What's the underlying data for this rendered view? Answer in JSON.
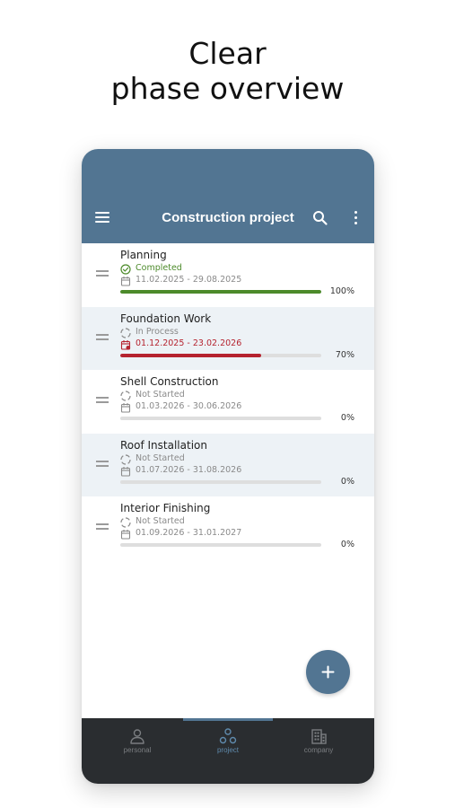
{
  "headline": {
    "line1": "Clear",
    "line2": "phase overview"
  },
  "appbar": {
    "title": "Construction project"
  },
  "phases": [
    {
      "name": "Planning",
      "status": "Completed",
      "status_type": "completed",
      "dates": "11.02.2025 - 29.08.2025",
      "date_overdue": false,
      "progress": 100,
      "progress_label": "100%"
    },
    {
      "name": "Foundation Work",
      "status": "In Process",
      "status_type": "in-process",
      "dates": "01.12.2025 - 23.02.2026",
      "date_overdue": true,
      "progress": 70,
      "progress_label": "70%"
    },
    {
      "name": "Shell Construction",
      "status": "Not Started",
      "status_type": "not-started",
      "dates": "01.03.2026 - 30.06.2026",
      "date_overdue": false,
      "progress": 0,
      "progress_label": "0%"
    },
    {
      "name": "Roof Installation",
      "status": "Not Started",
      "status_type": "not-started",
      "dates": "01.07.2026 - 31.08.2026",
      "date_overdue": false,
      "progress": 0,
      "progress_label": "0%"
    },
    {
      "name": "Interior Finishing",
      "status": "Not Started",
      "status_type": "not-started",
      "dates": "01.09.2026 - 31.01.2027",
      "date_overdue": false,
      "progress": 0,
      "progress_label": "0%"
    }
  ],
  "nav": {
    "items": [
      {
        "label": "personal",
        "icon": "person-icon",
        "active": false
      },
      {
        "label": "project",
        "icon": "project-icon",
        "active": true
      },
      {
        "label": "company",
        "icon": "building-icon",
        "active": false
      }
    ]
  },
  "colors": {
    "accent": "#527592",
    "completed": "#4c8a2a",
    "overdue": "#b5232f",
    "muted": "#8a8a8a",
    "nav_bg": "#2a2d30",
    "alt_row": "#edf2f6"
  }
}
